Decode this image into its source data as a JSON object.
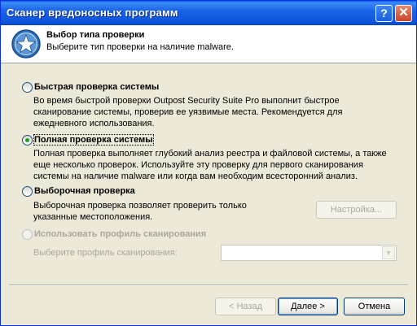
{
  "window": {
    "title": "Сканер вредоносных программ",
    "help_glyph": "?",
    "close_glyph": "✕"
  },
  "header": {
    "title": "Выбор типа проверки",
    "subtitle": "Выберите тип проверки на наличие malware."
  },
  "options": [
    {
      "label": "Быстрая проверка системы",
      "selected": false,
      "description": [
        "Во время быстрой проверки Outpost Security Suite Pro выполнит быстрое",
        "сканирование системы, проверив ее уязвимые места. Рекомендуется для",
        "ежедневного использования."
      ]
    },
    {
      "label": "Полная проверка системы",
      "selected": true,
      "description": [
        "Полная проверка выполняет глубокий анализ реестра и файловой системы, а также",
        "еще несколько проверок. Используйте эту проверку для первого сканирования",
        "системы на наличие malware или когда вам необходим всесторонний анализ."
      ]
    },
    {
      "label": "Выборочная проверка",
      "selected": false,
      "description": [
        "Выборочная проверка позволяет проверить только",
        "указанные местоположения."
      ]
    },
    {
      "label": "Использовать профиль сканирования",
      "selected": false,
      "disabled": true
    }
  ],
  "custom_settings_button": "Настройка...",
  "profile": {
    "label": "Выберите профиль сканирования:",
    "value": ""
  },
  "footer": {
    "back_button": "< Назад",
    "next_button": "Далее >",
    "cancel_button": "Отмена"
  },
  "colors": {
    "titlebar": "#0d55dc",
    "dialog_bg": "#ece9d8",
    "selected_dot": "#21a121",
    "disabled_text": "#aca899"
  }
}
